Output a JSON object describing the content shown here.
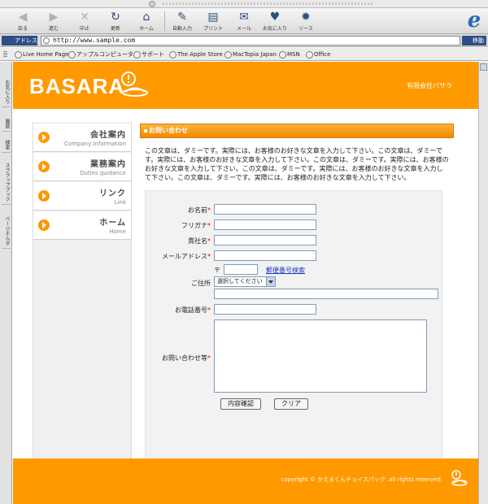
{
  "browser": {
    "toolbar": [
      {
        "label": "戻る",
        "icon": "◀",
        "dim": true
      },
      {
        "label": "進む",
        "icon": "▶",
        "dim": true
      },
      {
        "label": "中止",
        "icon": "✕",
        "dim": true
      },
      {
        "label": "更新",
        "icon": "↻",
        "dim": false
      },
      {
        "label": "ホーム",
        "icon": "⌂",
        "dim": false
      },
      {
        "label": "自動入力",
        "icon": "✎",
        "dim": false
      },
      {
        "label": "プリント",
        "icon": "▤",
        "dim": false
      },
      {
        "label": "メール",
        "icon": "✉",
        "dim": false
      },
      {
        "label": "お気に入り",
        "icon": "♥",
        "dim": false
      },
      {
        "label": "ソース",
        "icon": "✹",
        "dim": false
      }
    ],
    "address_label": "アドレス",
    "url": "http://www.sample.com",
    "go_label": "移動",
    "favorites": [
      "Live Home Page",
      "アップルコンピュータ",
      "サポート",
      "The Apple Store",
      "MacTopia Japan",
      "MSN",
      "Office"
    ],
    "side_tabs": [
      "お気に入り",
      "履歴",
      "検索",
      "スクラップブック",
      "ページホルダ"
    ]
  },
  "site": {
    "logo": "BASARA",
    "company": "有限会社バサラ",
    "nav": [
      {
        "jp": "会社案内",
        "en": "Company Information"
      },
      {
        "jp": "業務案内",
        "en": "Duties guidance"
      },
      {
        "jp": "リンク",
        "en": "Link"
      },
      {
        "jp": "ホーム",
        "en": "Home"
      }
    ],
    "section_title": "お問い合わせ",
    "intro": "この文章は、ダミーです。実際には、お客様のお好きな文章を入力して下さい。この文章は、ダミーです。実際には、お客様のお好きな文章を入力して下さい。この文章は、ダミーです。実際には、お客様のお好きな文章を入力して下さい。この文章は、ダミーです。実際には、お客様のお好きな文章を入力して下さい。この文章は、ダミーです。実際には、お客様のお好きな文章を入力して下さい。",
    "form": {
      "name_label": "お名前",
      "furigana_label": "フリガナ",
      "company_label": "貴社名",
      "email_label": "メールアドレス",
      "zip_mark": "〒",
      "zip_search": "郵便番号検索",
      "address_label": "ご住所",
      "prefecture_selected": "選択してください",
      "phone_label": "お電話番号",
      "inquiry_label": "お問い合わせ等",
      "required_mark": "*",
      "confirm_button": "内容確認",
      "clear_button": "クリア"
    },
    "copyright": "copyright © かえるくんチョイスパック .all rights reserved."
  }
}
